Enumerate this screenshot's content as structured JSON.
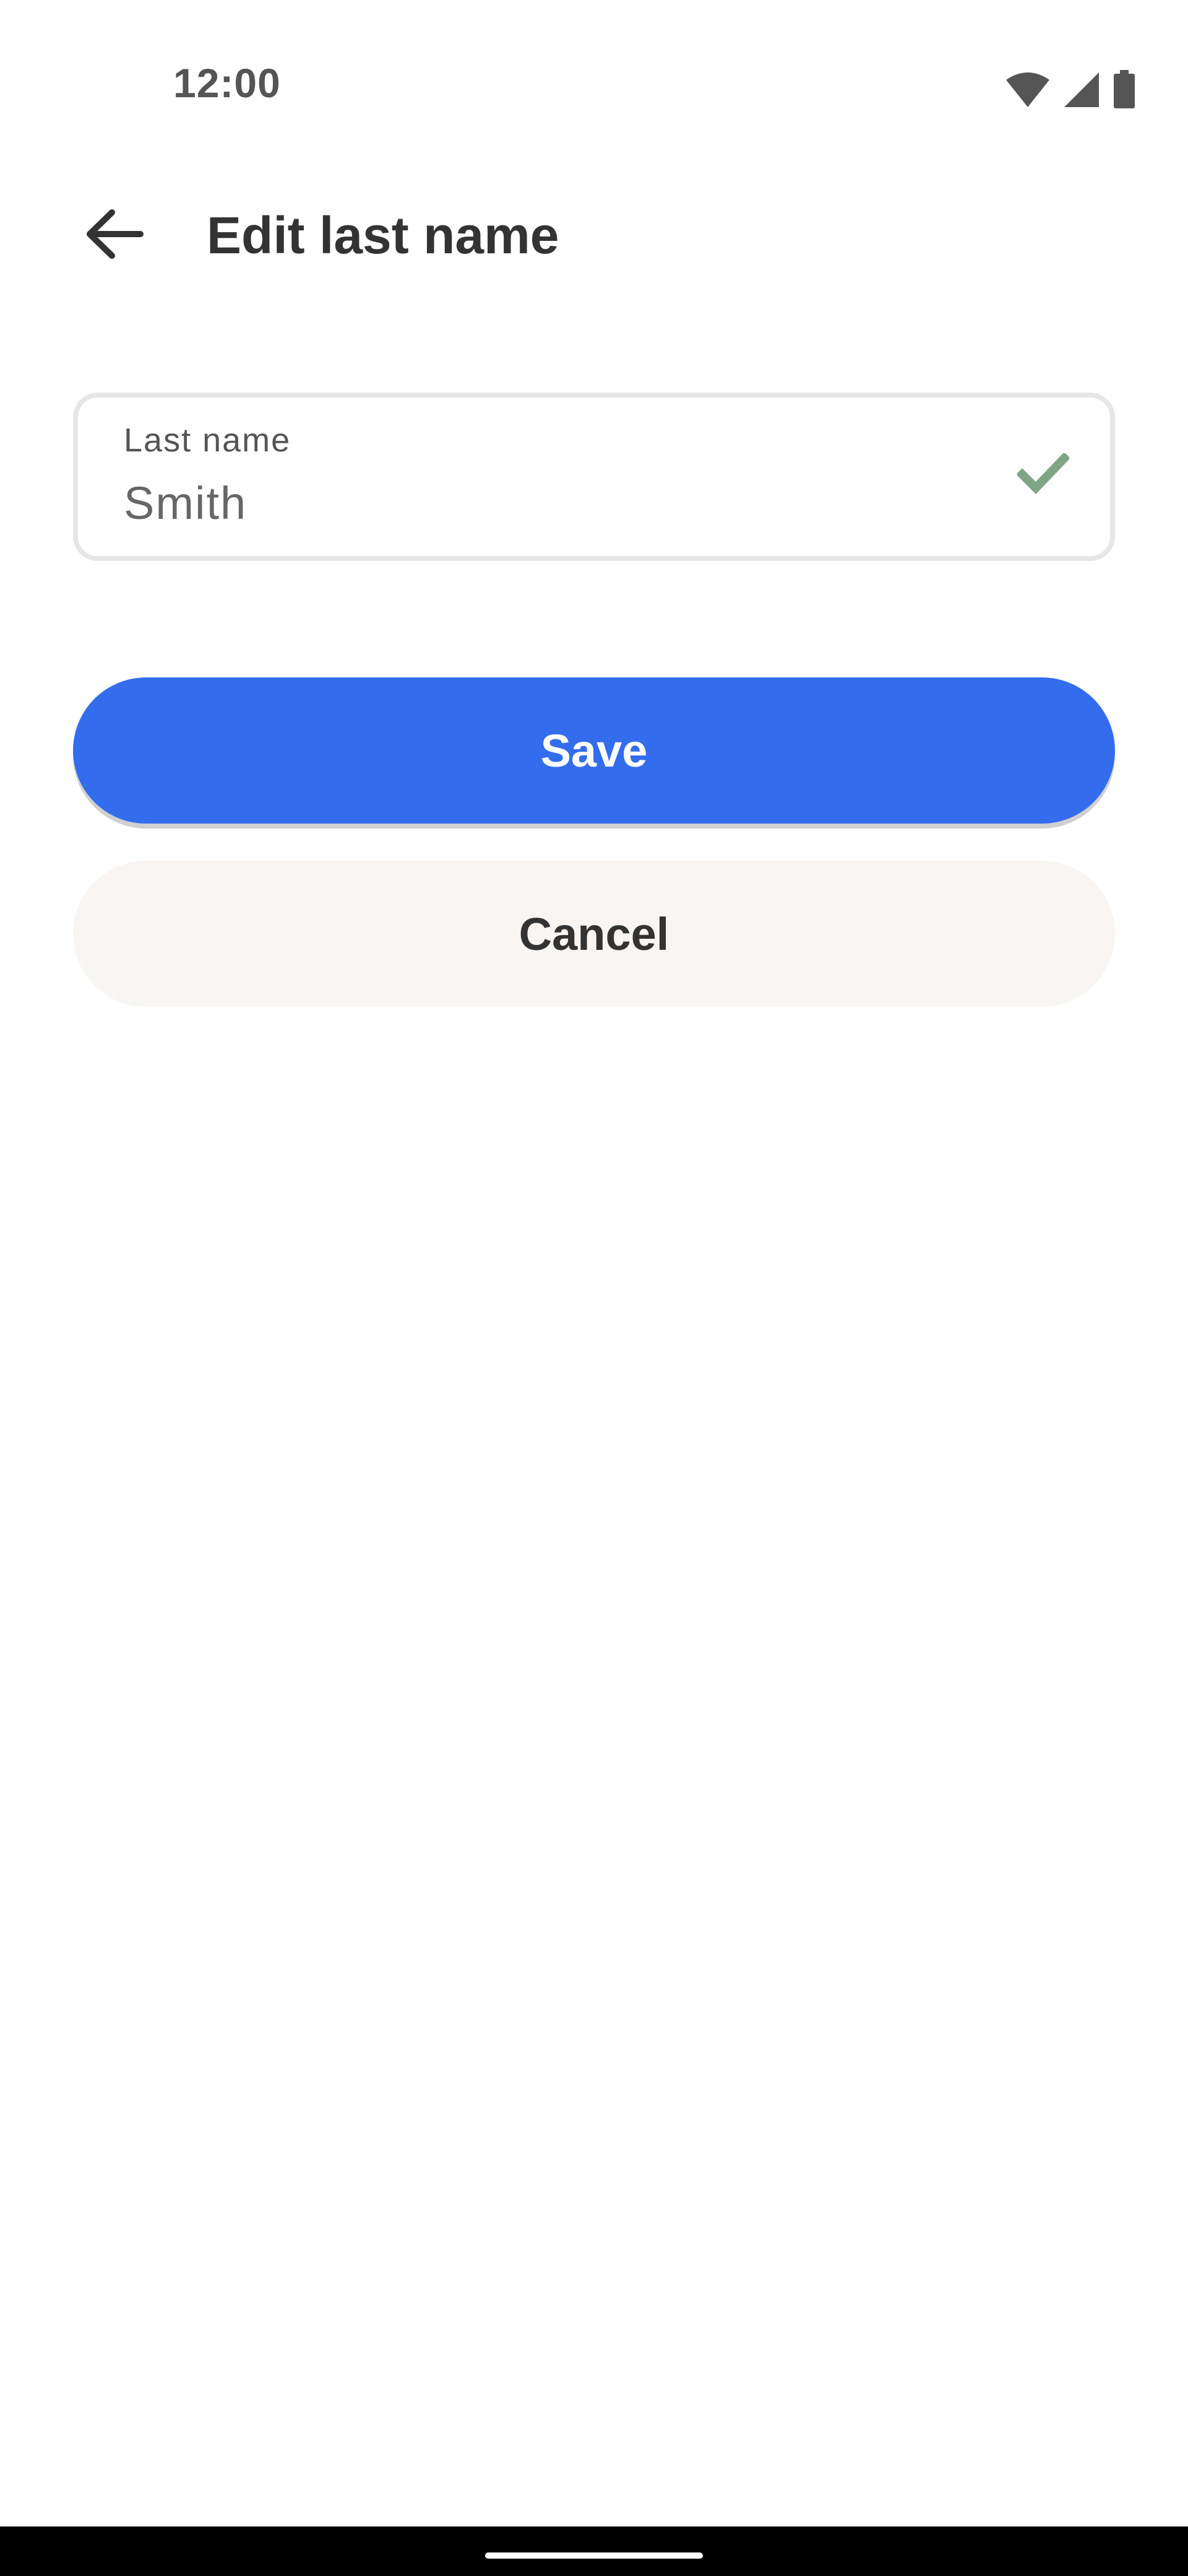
{
  "status_bar": {
    "time": "12:00",
    "icons": [
      "wifi-icon",
      "cellular-signal-icon",
      "battery-icon"
    ]
  },
  "app_bar": {
    "back_icon": "arrow-left-icon",
    "title": "Edit last name"
  },
  "form": {
    "last_name": {
      "label": "Last name",
      "value": "Smith",
      "status_icon": "checkmark-icon",
      "status_color": "#7fa585"
    }
  },
  "actions": {
    "save_label": "Save",
    "cancel_label": "Cancel"
  },
  "colors": {
    "primary": "#336ded",
    "secondary_button_bg": "#f8f5f2",
    "text": "#333333"
  }
}
